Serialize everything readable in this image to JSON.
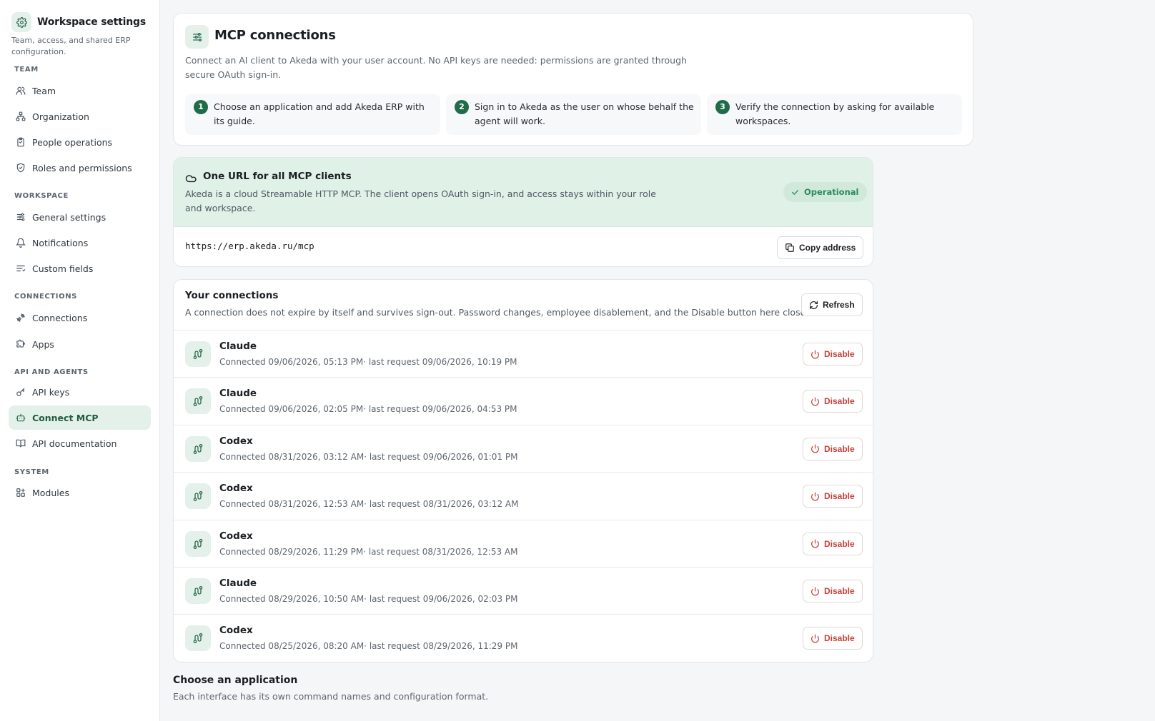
{
  "sidebar": {
    "title": "Workspace settings",
    "subtitle": "Team, access, and shared ERP configuration.",
    "sections": {
      "team": "TEAM",
      "workspace": "WORKSPACE",
      "connections": "CONNECTIONS",
      "api_agents": "API AND AGENTS",
      "system": "SYSTEM"
    },
    "items": [
      {
        "label": "Team",
        "icon": "users-icon"
      },
      {
        "label": "Organization",
        "icon": "organization-icon"
      },
      {
        "label": "People operations",
        "icon": "clipboard-icon"
      },
      {
        "label": "Roles and permissions",
        "icon": "shield-check-icon"
      },
      {
        "label": "General settings",
        "icon": "sliders-icon"
      },
      {
        "label": "Notifications",
        "icon": "bell-icon"
      },
      {
        "label": "Custom fields",
        "icon": "list-icon"
      },
      {
        "label": "Connections",
        "icon": "plug-icon"
      },
      {
        "label": "Apps",
        "icon": "puzzle-icon"
      },
      {
        "label": "API keys",
        "icon": "key-icon"
      },
      {
        "label": "Connect MCP",
        "icon": "bot-icon",
        "active": true
      },
      {
        "label": "API documentation",
        "icon": "book-icon"
      },
      {
        "label": "Modules",
        "icon": "modules-icon"
      }
    ]
  },
  "mcp": {
    "title": "MCP connections",
    "description": "Connect an AI client to Akeda with your user account. No API keys are needed: permissions are granted through secure OAuth sign-in.",
    "steps": [
      {
        "num": "1",
        "text": "Choose an application and add Akeda ERP with its guide."
      },
      {
        "num": "2",
        "text": "Sign in to Akeda as the user on whose behalf the agent will work."
      },
      {
        "num": "3",
        "text": "Verify the connection by asking for available workspaces."
      }
    ]
  },
  "url_card": {
    "title": "One URL for all MCP clients",
    "description": "Akeda is a cloud Streamable HTTP MCP. The client opens OAuth sign-in, and access stays within your role and workspace.",
    "status": "Operational",
    "url": "https://erp.akeda.ru/mcp",
    "copy_label": "Copy address"
  },
  "connections": {
    "title": "Your connections",
    "description": "A connection does not expire by itself and survives sign-out. Password changes, employee disablement, and the Disable button here close it.",
    "refresh_label": "Refresh",
    "disable_label": "Disable",
    "rows": [
      {
        "name": "Claude",
        "meta": "Connected 09/06/2026, 05:13 PM· last request 09/06/2026, 10:19 PM"
      },
      {
        "name": "Claude",
        "meta": "Connected 09/06/2026, 02:05 PM· last request 09/06/2026, 04:53 PM"
      },
      {
        "name": "Codex",
        "meta": "Connected 08/31/2026, 03:12 AM· last request 09/06/2026, 01:01 PM"
      },
      {
        "name": "Codex",
        "meta": "Connected 08/31/2026, 12:53 AM· last request 08/31/2026, 03:12 AM"
      },
      {
        "name": "Codex",
        "meta": "Connected 08/29/2026, 11:29 PM· last request 08/31/2026, 12:53 AM"
      },
      {
        "name": "Claude",
        "meta": "Connected 08/29/2026, 10:50 AM· last request 09/06/2026, 02:03 PM"
      },
      {
        "name": "Codex",
        "meta": "Connected 08/25/2026, 08:20 AM· last request 08/29/2026, 11:29 PM"
      }
    ]
  },
  "choose": {
    "title": "Choose an application",
    "description": "Each interface has its own command names and configuration format."
  },
  "colors": {
    "accent": "#1f6b4a",
    "accent_bg": "#e3f1ea",
    "status_green": "#2c8a5c",
    "danger": "#c4423b"
  }
}
